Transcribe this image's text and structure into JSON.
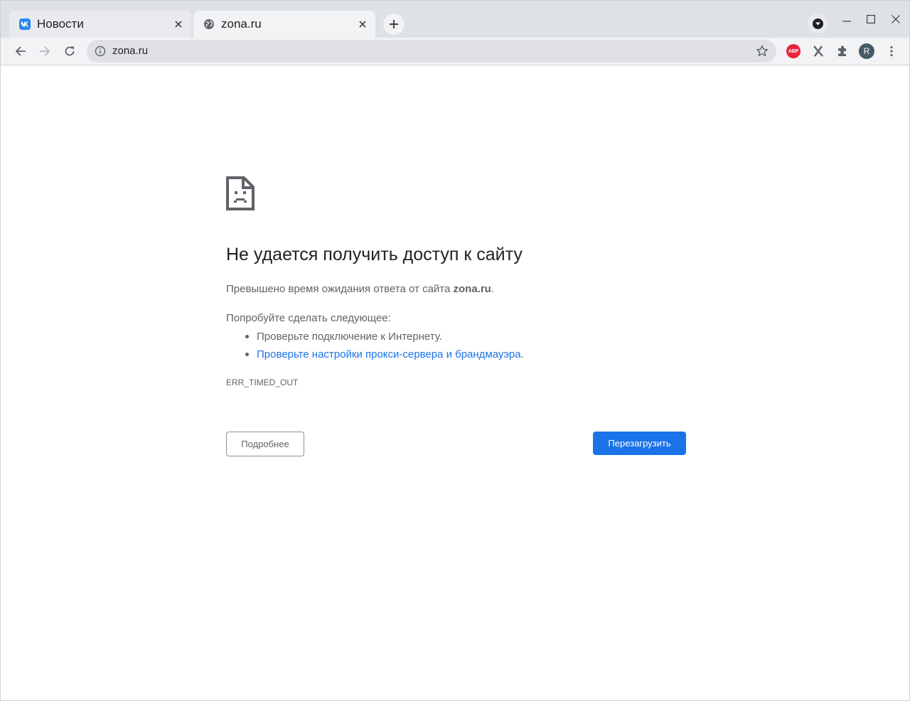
{
  "tabs": [
    {
      "title": "Новости",
      "favicon": "vk-icon",
      "active": false
    },
    {
      "title": "zona.ru",
      "favicon": "globe-icon",
      "active": true
    }
  ],
  "toolbar": {
    "url": "zona.ru",
    "extensions": [
      "adblock-plus-icon",
      "x-extension-icon",
      "puzzle-extensions-icon"
    ],
    "profile_initial": "R"
  },
  "error_page": {
    "heading": "Не удается получить доступ к сайту",
    "summary_prefix": "Превышено время ожидания ответа от сайта ",
    "summary_host": "zona.ru",
    "summary_suffix": ".",
    "suggestions_heading": "Попробуйте сделать следующее:",
    "suggestions": [
      {
        "text": "Проверьте подключение к Интернету."
      },
      {
        "link_text": "Проверьте настройки прокси-сервера и брандмауэра",
        "suffix": "."
      }
    ],
    "error_code": "ERR_TIMED_OUT",
    "details_button": "Подробнее",
    "reload_button": "Перезагрузить"
  },
  "colors": {
    "accent": "#1a73e8",
    "tabstrip": "#dee1e6",
    "toolbar": "#f1f3f4",
    "text_secondary": "#5f6368"
  }
}
